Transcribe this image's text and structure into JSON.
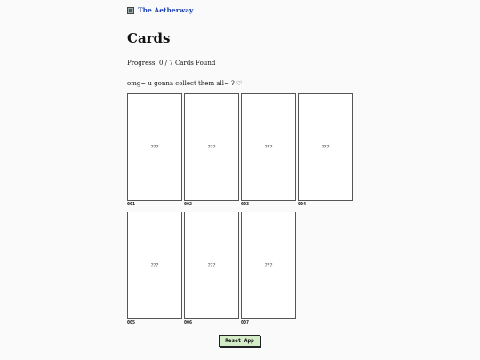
{
  "header": {
    "site_icon": "site-logo-icon",
    "site_name": "The Aetherway"
  },
  "page": {
    "title": "Cards",
    "progress": "Progress: 0 / 7 Cards Found",
    "tagline": "omg~ u gonna collect them all~ ? ♡"
  },
  "cards": [
    {
      "face": "???",
      "number": "001"
    },
    {
      "face": "???",
      "number": "002"
    },
    {
      "face": "???",
      "number": "003"
    },
    {
      "face": "???",
      "number": "004"
    },
    {
      "face": "???",
      "number": "005"
    },
    {
      "face": "???",
      "number": "006"
    },
    {
      "face": "???",
      "number": "007"
    }
  ],
  "actions": {
    "reset_label": "Reset App"
  },
  "colors": {
    "link": "#1a3fb0",
    "button_bg": "#d5ecc8",
    "background": "#fafafa"
  }
}
